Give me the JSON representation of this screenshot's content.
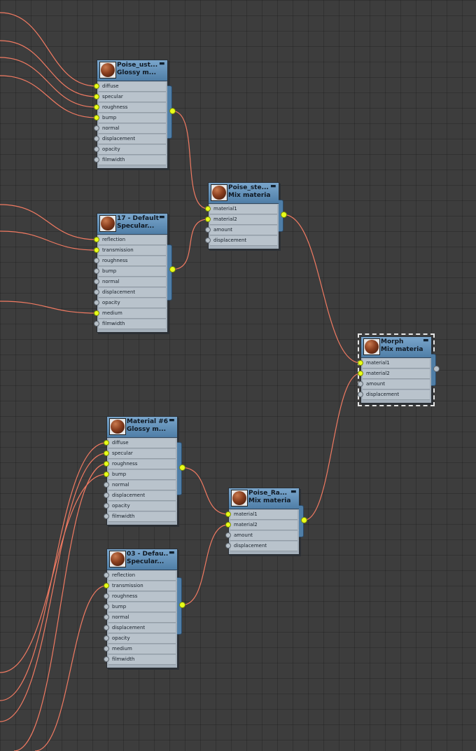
{
  "nodes": [
    {
      "id": "poise_ust",
      "title_line1": "Poise_ust...",
      "title_line2": "Glossy m...",
      "output_connected": true,
      "slots": [
        {
          "label": "diffuse",
          "connected": true
        },
        {
          "label": "specular",
          "connected": true
        },
        {
          "label": "roughness",
          "connected": true
        },
        {
          "label": "bump",
          "connected": true
        },
        {
          "label": "normal",
          "connected": false
        },
        {
          "label": "displacement",
          "connected": false
        },
        {
          "label": "opacity",
          "connected": false
        },
        {
          "label": "filmwidth",
          "connected": false
        }
      ]
    },
    {
      "id": "default17",
      "title_line1": "17 - Default",
      "title_line2": "Specular...",
      "output_connected": true,
      "slots": [
        {
          "label": "reflection",
          "connected": true
        },
        {
          "label": "transmission",
          "connected": true
        },
        {
          "label": "roughness",
          "connected": false
        },
        {
          "label": "bump",
          "connected": false
        },
        {
          "label": "normal",
          "connected": false
        },
        {
          "label": "displacement",
          "connected": false
        },
        {
          "label": "opacity",
          "connected": false
        },
        {
          "label": "medium",
          "connected": true
        },
        {
          "label": "filmwidth",
          "connected": false
        }
      ]
    },
    {
      "id": "poise_ste",
      "title_line1": "Poise_ste...",
      "title_line2": "Mix material",
      "output_connected": true,
      "slots": [
        {
          "label": "material1",
          "connected": true
        },
        {
          "label": "material2",
          "connected": true
        },
        {
          "label": "amount",
          "connected": false
        },
        {
          "label": "displacement",
          "connected": false
        }
      ]
    },
    {
      "id": "morph",
      "title_line1": "Morph",
      "title_line2": "Mix material",
      "output_connected": false,
      "selected": true,
      "slots": [
        {
          "label": "material1",
          "connected": true
        },
        {
          "label": "material2",
          "connected": true
        },
        {
          "label": "amount",
          "connected": false
        },
        {
          "label": "displacement",
          "connected": false
        }
      ]
    },
    {
      "id": "material6",
      "title_line1": "Material #6",
      "title_line2": "Glossy m...",
      "output_connected": true,
      "slots": [
        {
          "label": "diffuse",
          "connected": true
        },
        {
          "label": "specular",
          "connected": true
        },
        {
          "label": "roughness",
          "connected": true
        },
        {
          "label": "bump",
          "connected": true
        },
        {
          "label": "normal",
          "connected": false
        },
        {
          "label": "displacement",
          "connected": false
        },
        {
          "label": "opacity",
          "connected": false
        },
        {
          "label": "filmwidth",
          "connected": false
        }
      ]
    },
    {
      "id": "poise_ra",
      "title_line1": "Poise_Ra...",
      "title_line2": "Mix material",
      "output_connected": true,
      "slots": [
        {
          "label": "material1",
          "connected": true
        },
        {
          "label": "material2",
          "connected": true
        },
        {
          "label": "amount",
          "connected": false
        },
        {
          "label": "displacement",
          "connected": false
        }
      ]
    },
    {
      "id": "default03",
      "title_line1": "03 - Defau...",
      "title_line2": "Specular...",
      "output_connected": true,
      "slots": [
        {
          "label": "reflection",
          "connected": false
        },
        {
          "label": "transmission",
          "connected": true
        },
        {
          "label": "roughness",
          "connected": false
        },
        {
          "label": "bump",
          "connected": false
        },
        {
          "label": "normal",
          "connected": false
        },
        {
          "label": "displacement",
          "connected": false
        },
        {
          "label": "opacity",
          "connected": false
        },
        {
          "label": "medium",
          "connected": false
        },
        {
          "label": "filmwidth",
          "connected": false
        }
      ]
    }
  ],
  "links": [
    {
      "from": "poise_ust",
      "to": "poise_ste",
      "slot": 0
    },
    {
      "from": "default17",
      "to": "poise_ste",
      "slot": 1
    },
    {
      "from": "poise_ste",
      "to": "morph",
      "slot": 0
    },
    {
      "from": "material6",
      "to": "poise_ra",
      "slot": 0
    },
    {
      "from": "default03",
      "to": "poise_ra",
      "slot": 1
    },
    {
      "from": "poise_ra",
      "to": "morph",
      "slot": 1
    }
  ],
  "colors": {
    "wire": "#f07a62",
    "port_connected": "#e8ff1a",
    "header": "#5d8db5",
    "background": "#3d3d3d"
  },
  "icons": {
    "node_thumbnail": "material-sphere-icon",
    "minimize": "minimize-icon"
  }
}
